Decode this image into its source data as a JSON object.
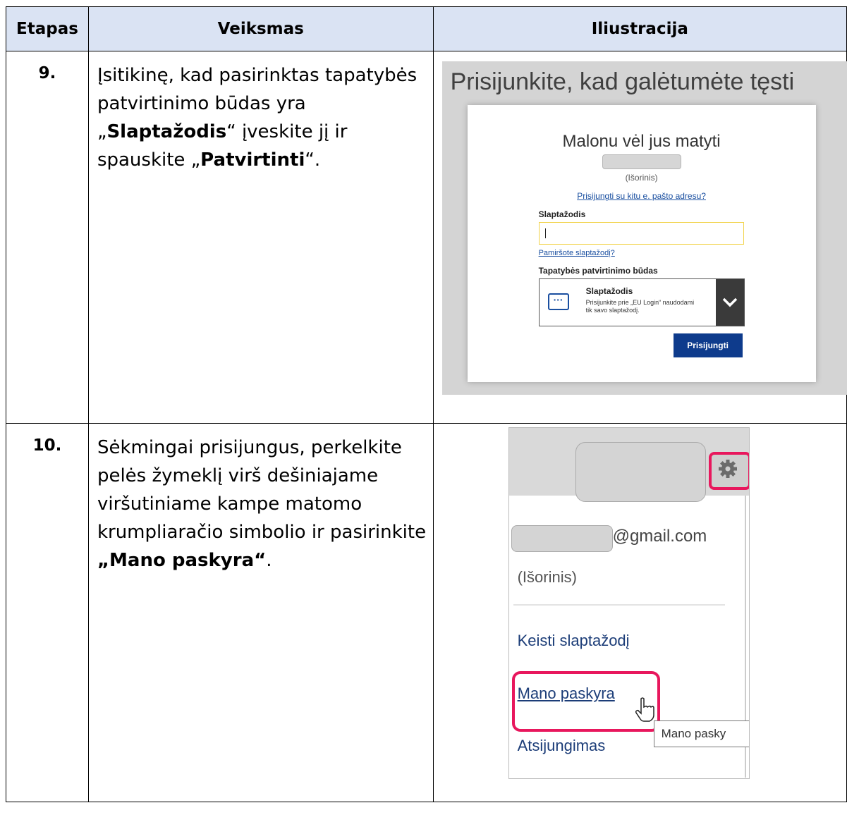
{
  "table": {
    "headers": [
      "Etapas",
      "Veiksmas",
      "Iliustracija"
    ]
  },
  "row9": {
    "step": "9.",
    "action_parts": [
      "Įsitikinę, kad  pasirinktas tapatybės patvirtinimo būdas yra „",
      "Slaptažodis",
      "“ įveskite jį ir spauskite „",
      "Patvirtinti",
      "“."
    ]
  },
  "login_screenshot": {
    "title": "Prisijunkite, kad galėtumėte tęsti",
    "welcome": "Malonu vėl jus matyti",
    "account_type": "(Išorinis)",
    "other_email_link": "Prisijungti su kitu e. pašto adresu?",
    "password_label": "Slaptažodis",
    "forgot_link": "Pamiršote slaptažodį?",
    "method_label": "Tapatybės patvirtinimo būdas",
    "method_title": "Slaptažodis",
    "method_description": "Prisijunkite prie „EU Login“ naudodami tik savo slaptažodį.",
    "method_icon": "dots-box-icon",
    "submit_label": "Prisijungti",
    "colors": {
      "submit": "#0e3b8c",
      "input_border": "#f2d34a",
      "link": "#1a4fa0"
    }
  },
  "row10": {
    "step": "10.",
    "action_parts": [
      "Sėkmingai prisijungus, perkelkite pelės žymeklį virš dešiniajame viršutiniame kampe matomo krumpliaračio simbolio ir pasirinkite ",
      "„Mano paskyra“",
      "."
    ]
  },
  "menu_screenshot": {
    "email_domain": "@gmail.com",
    "account_type": "(Išorinis)",
    "items": [
      "Keisti slaptažodį",
      "Mano paskyra",
      "Atsijungimas"
    ],
    "tooltip": "Mano pasky",
    "highlight_color": "#e8175d"
  }
}
